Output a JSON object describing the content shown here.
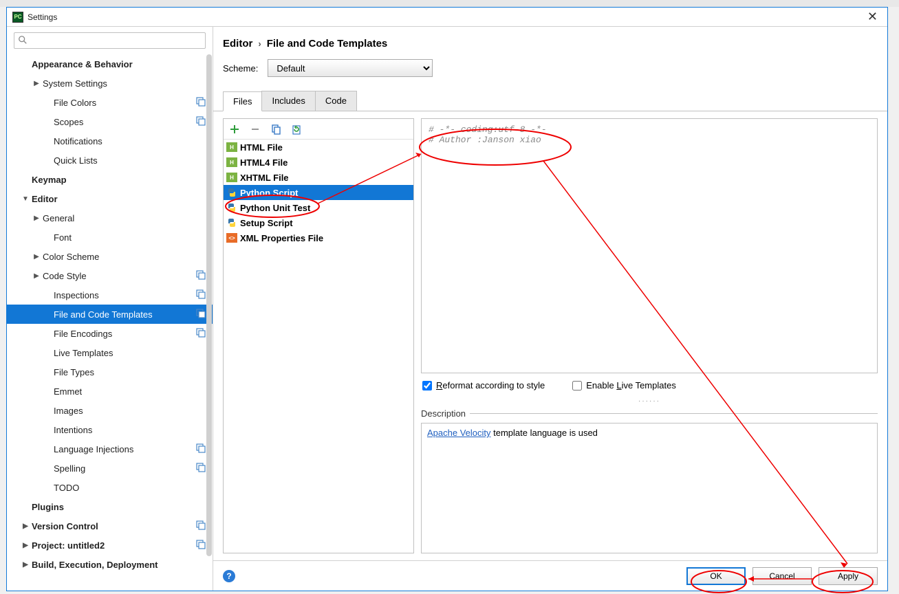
{
  "window": {
    "title": "Settings"
  },
  "search": {
    "placeholder": ""
  },
  "sidebar": {
    "items": [
      {
        "label": "Appearance & Behavior",
        "bold": true,
        "indent": 0,
        "arrow": "",
        "badge": false
      },
      {
        "label": "System Settings",
        "bold": false,
        "indent": 1,
        "arrow": "right",
        "badge": false
      },
      {
        "label": "File Colors",
        "bold": false,
        "indent": 2,
        "arrow": "",
        "badge": true
      },
      {
        "label": "Scopes",
        "bold": false,
        "indent": 2,
        "arrow": "",
        "badge": true
      },
      {
        "label": "Notifications",
        "bold": false,
        "indent": 2,
        "arrow": "",
        "badge": false
      },
      {
        "label": "Quick Lists",
        "bold": false,
        "indent": 2,
        "arrow": "",
        "badge": false
      },
      {
        "label": "Keymap",
        "bold": true,
        "indent": 0,
        "arrow": "",
        "badge": false
      },
      {
        "label": "Editor",
        "bold": true,
        "indent": 0,
        "arrow": "down",
        "badge": false
      },
      {
        "label": "General",
        "bold": false,
        "indent": 1,
        "arrow": "right",
        "badge": false
      },
      {
        "label": "Font",
        "bold": false,
        "indent": 2,
        "arrow": "",
        "badge": false
      },
      {
        "label": "Color Scheme",
        "bold": false,
        "indent": 1,
        "arrow": "right",
        "badge": false
      },
      {
        "label": "Code Style",
        "bold": false,
        "indent": 1,
        "arrow": "right",
        "badge": true
      },
      {
        "label": "Inspections",
        "bold": false,
        "indent": 2,
        "arrow": "",
        "badge": true
      },
      {
        "label": "File and Code Templates",
        "bold": false,
        "indent": 2,
        "arrow": "",
        "badge": true,
        "selected": true
      },
      {
        "label": "File Encodings",
        "bold": false,
        "indent": 2,
        "arrow": "",
        "badge": true
      },
      {
        "label": "Live Templates",
        "bold": false,
        "indent": 2,
        "arrow": "",
        "badge": false
      },
      {
        "label": "File Types",
        "bold": false,
        "indent": 2,
        "arrow": "",
        "badge": false
      },
      {
        "label": "Emmet",
        "bold": false,
        "indent": 2,
        "arrow": "",
        "badge": false
      },
      {
        "label": "Images",
        "bold": false,
        "indent": 2,
        "arrow": "",
        "badge": false
      },
      {
        "label": "Intentions",
        "bold": false,
        "indent": 2,
        "arrow": "",
        "badge": false
      },
      {
        "label": "Language Injections",
        "bold": false,
        "indent": 2,
        "arrow": "",
        "badge": true
      },
      {
        "label": "Spelling",
        "bold": false,
        "indent": 2,
        "arrow": "",
        "badge": true
      },
      {
        "label": "TODO",
        "bold": false,
        "indent": 2,
        "arrow": "",
        "badge": false
      },
      {
        "label": "Plugins",
        "bold": true,
        "indent": 0,
        "arrow": "",
        "badge": false
      },
      {
        "label": "Version Control",
        "bold": true,
        "indent": 0,
        "arrow": "right",
        "badge": true
      },
      {
        "label": "Project: untitled2",
        "bold": true,
        "indent": 0,
        "arrow": "right",
        "badge": true
      },
      {
        "label": "Build, Execution, Deployment",
        "bold": true,
        "indent": 0,
        "arrow": "right",
        "badge": false
      }
    ]
  },
  "breadcrumb": {
    "parent": "Editor",
    "sep": "›",
    "current": "File and Code Templates"
  },
  "scheme": {
    "label": "Scheme:",
    "value": "Default"
  },
  "tabs": [
    {
      "label": "Files",
      "active": true
    },
    {
      "label": "Includes",
      "active": false
    },
    {
      "label": "Code",
      "active": false
    }
  ],
  "fileTemplates": [
    {
      "label": "HTML File",
      "icon": "html",
      "selected": false
    },
    {
      "label": "HTML4 File",
      "icon": "html",
      "selected": false
    },
    {
      "label": "XHTML File",
      "icon": "html",
      "selected": false
    },
    {
      "label": "Python Script",
      "icon": "py",
      "selected": true
    },
    {
      "label": "Python Unit Test",
      "icon": "py",
      "selected": false
    },
    {
      "label": "Setup Script",
      "icon": "py",
      "selected": false
    },
    {
      "label": "XML Properties File",
      "icon": "xml",
      "selected": false
    }
  ],
  "templateCode": "# -*- coding:utf-8 -*-\n# Author :Janson xiao",
  "options": {
    "reformat": {
      "label_pre": "R",
      "label_post": "eformat according to style",
      "checked": true
    },
    "enableLive": {
      "label_pre": "Enable ",
      "label_u": "L",
      "label_post": "ive Templates",
      "checked": false
    }
  },
  "description": {
    "label": "Description",
    "link": "Apache Velocity",
    "text": " template language is used"
  },
  "buttons": {
    "ok": "OK",
    "cancel": "Cancel",
    "apply": "Apply"
  }
}
